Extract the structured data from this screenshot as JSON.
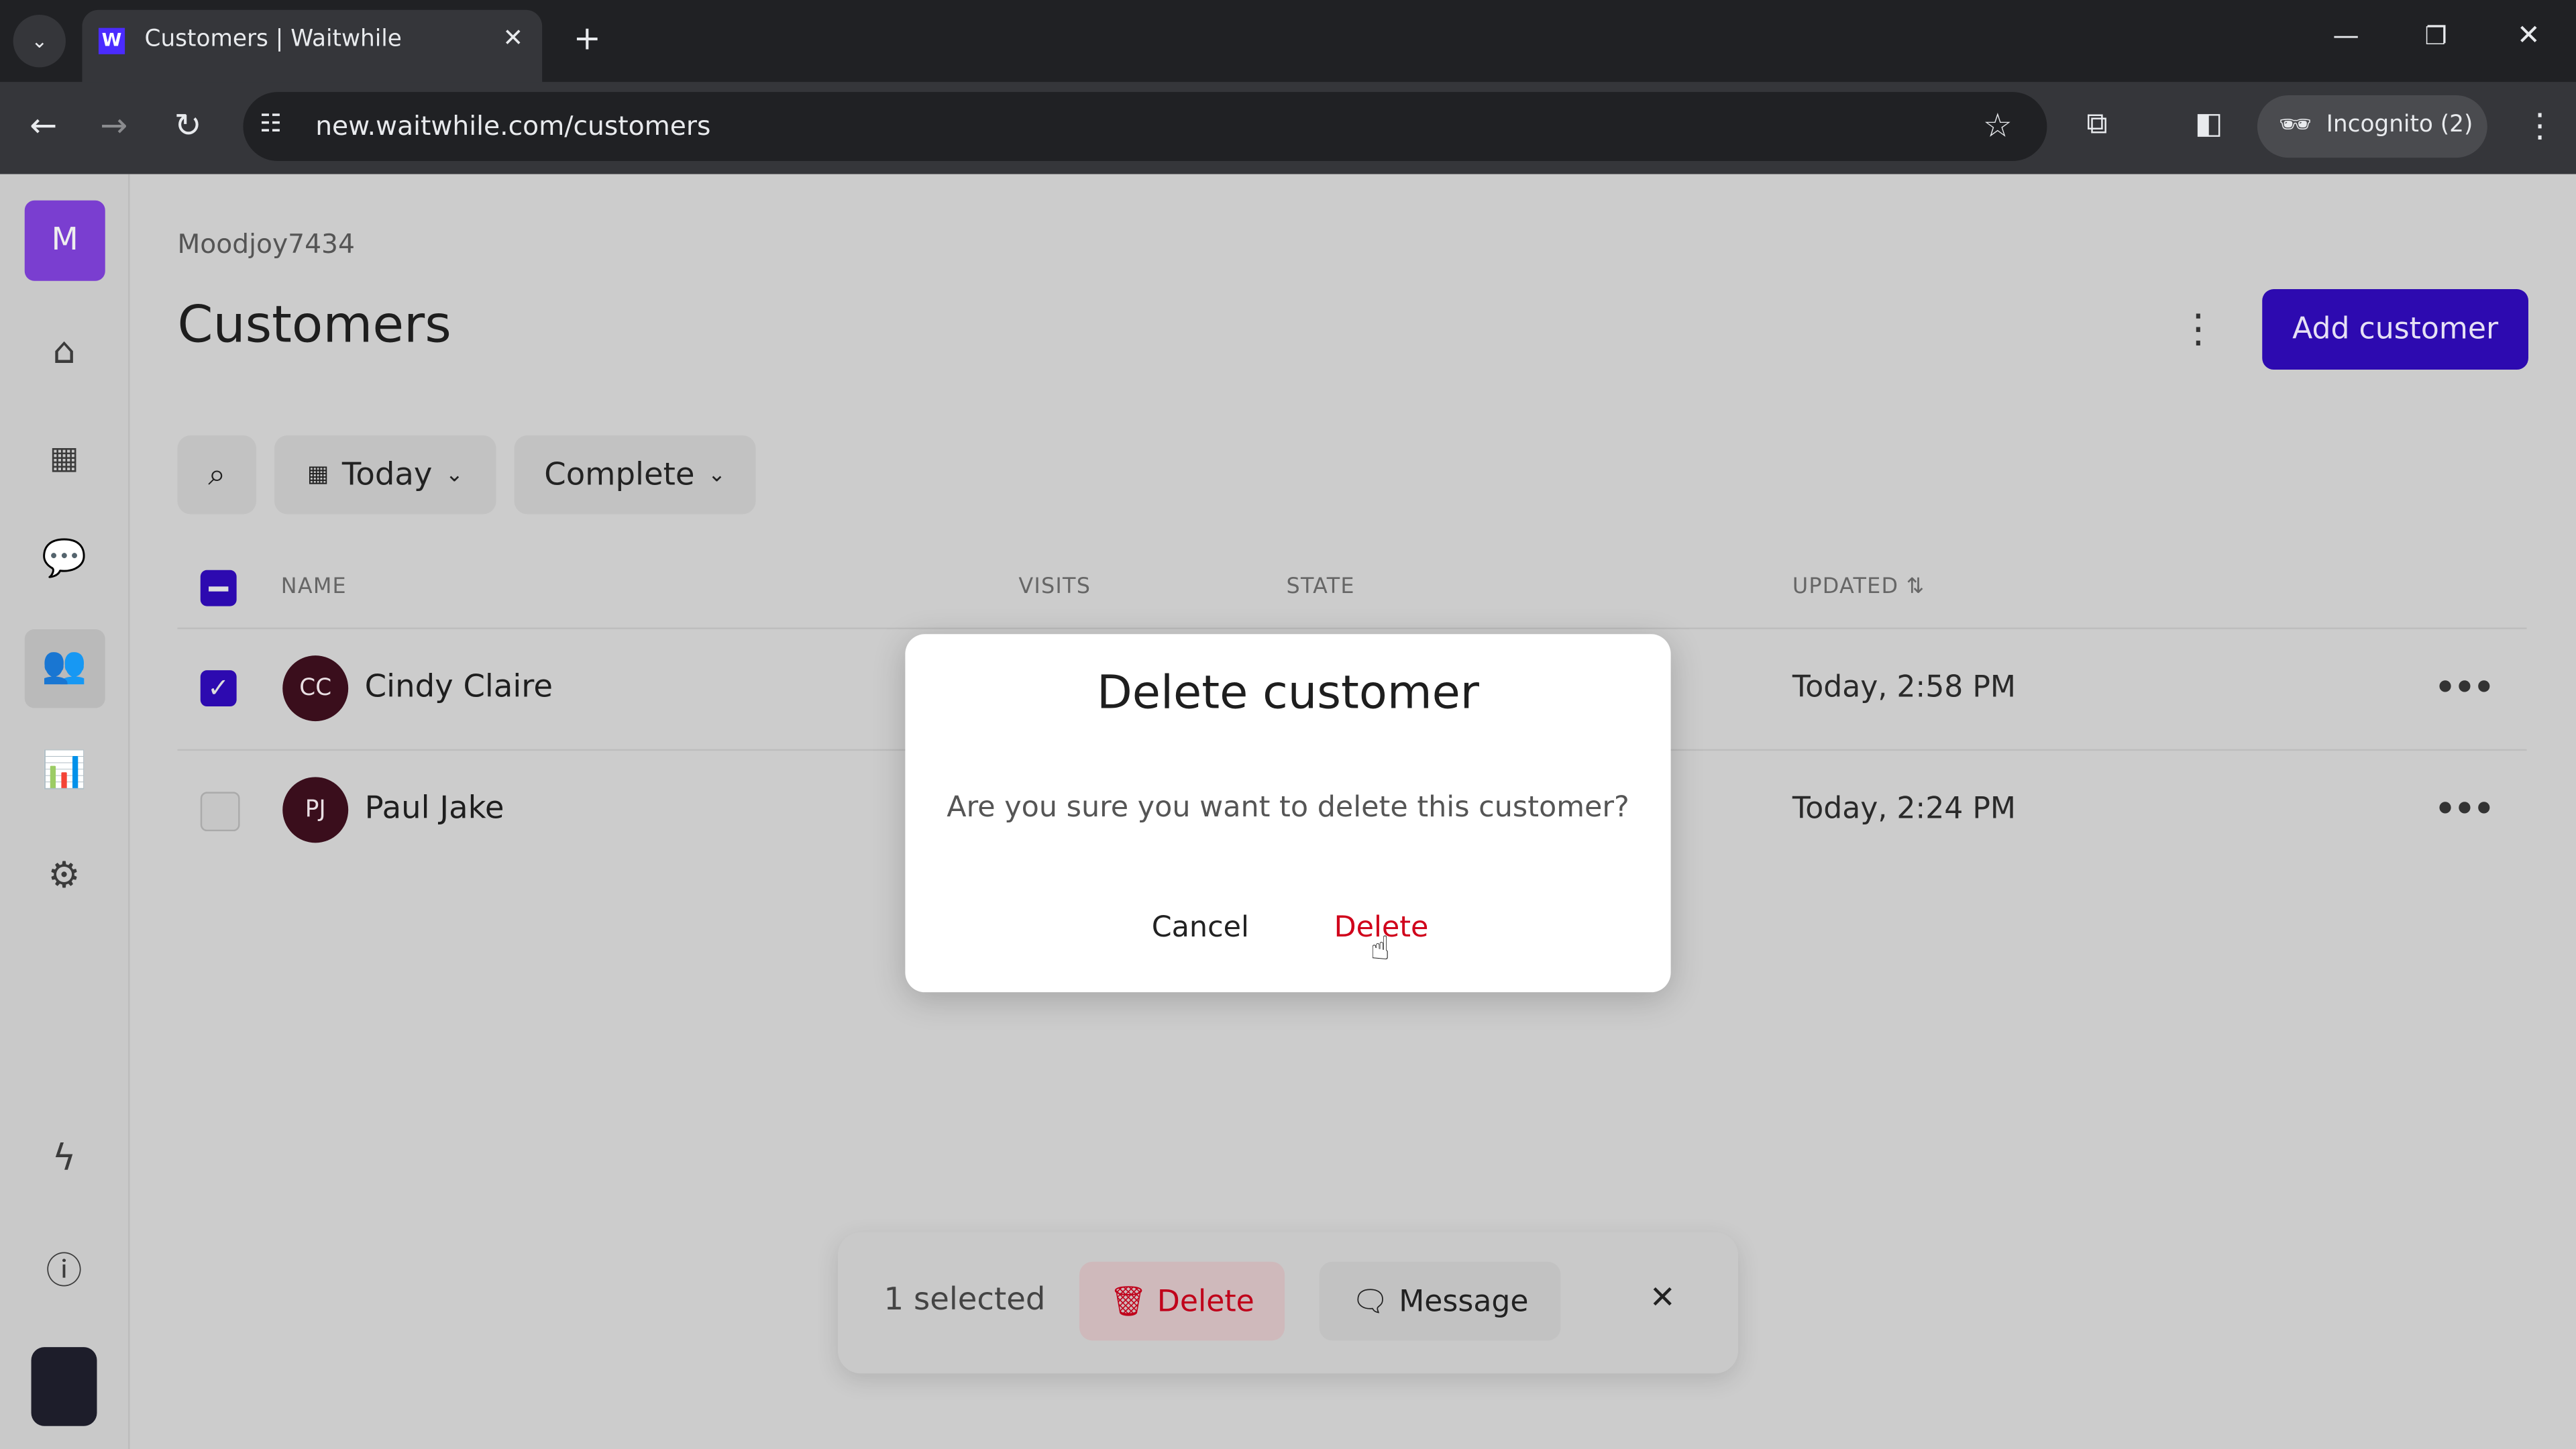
{
  "browser": {
    "tab_title": "Customers | Waitwhile",
    "url": "new.waitwhile.com/customers",
    "profile": "Incognito (2)"
  },
  "sidebar": {
    "org_initial": "M",
    "items": [
      {
        "icon": "home-icon"
      },
      {
        "icon": "calendar-icon"
      },
      {
        "icon": "chat-icon"
      },
      {
        "icon": "customers-icon",
        "active": true
      },
      {
        "icon": "analytics-icon"
      },
      {
        "icon": "settings-icon"
      },
      {
        "icon": "lightning-icon"
      },
      {
        "icon": "help-icon"
      }
    ]
  },
  "page": {
    "account": "Moodjoy7434",
    "title": "Customers",
    "add_button": "Add customer",
    "accent": "#2d0ab0"
  },
  "filters": {
    "date": "Today",
    "status": "Complete"
  },
  "table": {
    "headers": {
      "name": "NAME",
      "visits": "VISITS",
      "state": "STATE",
      "updated": "UPDATED"
    },
    "rows": [
      {
        "initials": "CC",
        "name": "Cindy Claire",
        "updated": "Today, 2:58 PM",
        "checked": true
      },
      {
        "initials": "PJ",
        "name": "Paul Jake",
        "updated": "Today, 2:24 PM",
        "checked": false
      }
    ]
  },
  "dialog": {
    "title": "Delete customer",
    "message": "Are you sure you want to delete this customer?",
    "cancel": "Cancel",
    "confirm": "Delete",
    "confirm_color": "#d0021b"
  },
  "selection_bar": {
    "count": "1 selected",
    "delete": "Delete",
    "message": "Message"
  }
}
